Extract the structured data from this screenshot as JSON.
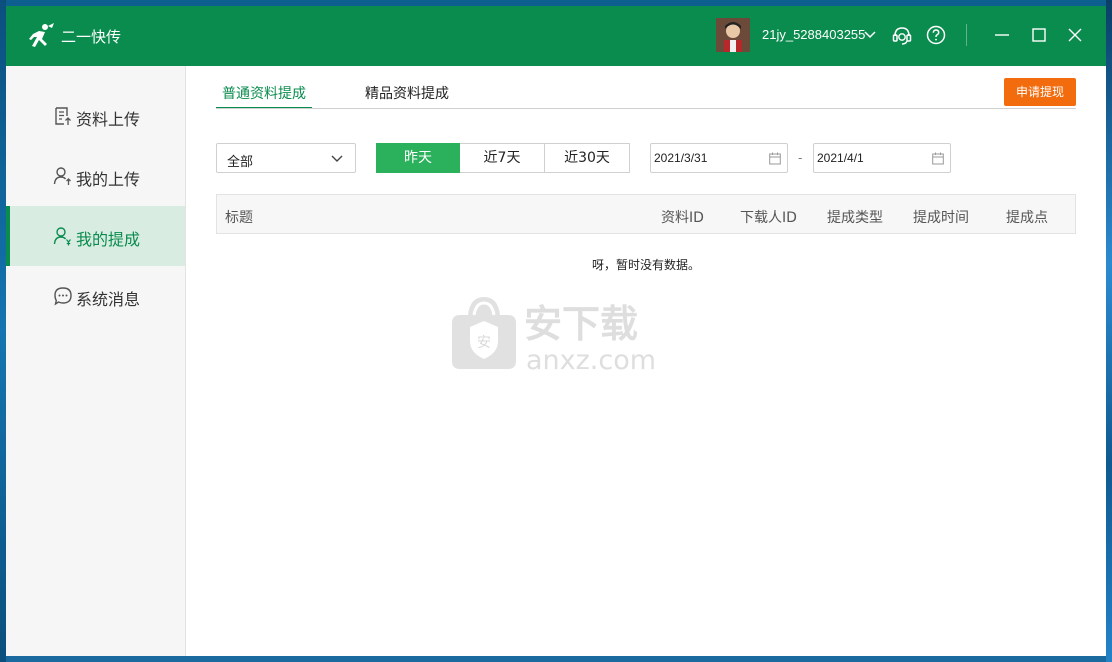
{
  "app": {
    "title": "二一快传"
  },
  "user": {
    "name": "21jy_5288403255"
  },
  "icons": {
    "logo": "running-man-icon",
    "chevron": "chevron-down-icon",
    "support": "headset-icon",
    "help": "help-icon",
    "minimize": "minimize-icon",
    "maximize": "maximize-icon",
    "close": "close-icon",
    "calendar": "calendar-icon"
  },
  "colors": {
    "brand": "#0a8c4e",
    "accent": "#2bb15c",
    "warning_button": "#f26b0d"
  },
  "sidebar": {
    "items": [
      {
        "label": "资料上传",
        "icon": "document-upload-icon",
        "active": false
      },
      {
        "label": "我的上传",
        "icon": "user-upload-icon",
        "active": false
      },
      {
        "label": "我的提成",
        "icon": "user-money-icon",
        "active": true
      },
      {
        "label": "系统消息",
        "icon": "chat-bubble-icon",
        "active": false
      }
    ]
  },
  "tabs": [
    {
      "label": "普通资料提成",
      "active": true
    },
    {
      "label": "精品资料提成",
      "active": false
    }
  ],
  "apply_button": "申请提现",
  "filter": {
    "selected": "全部",
    "ranges": [
      {
        "label": "昨天",
        "active": true
      },
      {
        "label": "近7天",
        "active": false
      },
      {
        "label": "近30天",
        "active": false
      }
    ],
    "start_date": "2021/3/31",
    "end_date": "2021/4/1",
    "separator": "-"
  },
  "table": {
    "columns": [
      "标题",
      "资料ID",
      "下载人ID",
      "提成类型",
      "提成时间",
      "提成点"
    ],
    "rows": [],
    "empty_text": "呀，暂时没有数据。"
  },
  "watermark": {
    "text": "安下载",
    "domain": "anxz.com",
    "badge": "安"
  }
}
